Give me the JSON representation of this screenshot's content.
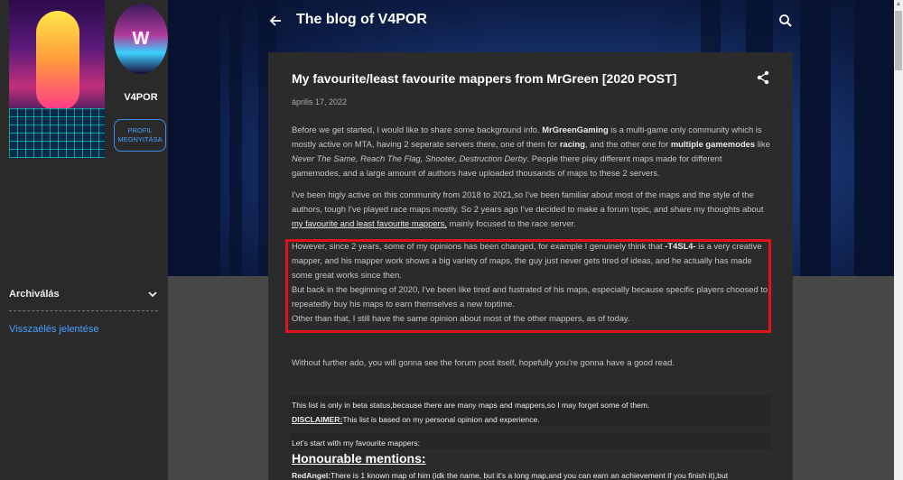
{
  "sidebar": {
    "profile_name": "V4POR",
    "profile_button_label": "PROFIL MEGNYITÁSA",
    "avatar_initial": "W",
    "archive_label": "Archiválás",
    "report_link": "Visszaélés jelentése",
    "icons": {
      "archive": "chevron-down-icon"
    }
  },
  "header": {
    "title": "The blog of V4POR",
    "icons": {
      "back": "arrow-left-icon",
      "search": "search-icon"
    }
  },
  "post": {
    "title": "My favourite/least favourite mappers from MrGreen [2020 POST]",
    "date": "április 17, 2022",
    "share_icon": "share-icon",
    "p1": {
      "t1": "Before we get started, I would like to share some background info. ",
      "b1": "MrGreenGaming",
      "t2": " is a multi-game only community which is mostly active on MTA, having 2 seperate servers there, one of them for ",
      "b2": "racing",
      "t3": ", and the other one for ",
      "b3": "multiple gamemodes",
      "t4": " like ",
      "i1": "Never The Same, Reach The Flag, Shooter, Destruction Derby",
      "t5": ". People there play different maps made for different gamemodes, and a large amount of authors have uploaded thousands of maps to these 2 servers."
    },
    "p2": {
      "t1": "I've been higly active on this community from 2018 to 2021,so I've been familiar about most of the maps and the style of the authors, tough I've played race maps mostly. So 2 years ago I've decided to make a forum topic, and share my thoughts about",
      "u1": " my favourite and least favourite mappers,",
      "t2": " mainly focused to the race server."
    },
    "p3": {
      "t1": "However, since 2 years, some of my opinions has been changed, for example I genuinely think that ",
      "b1": "-T4SL4-",
      "t2": " is a very creative mapper, and his mapper work shows a big variety of maps, the guy just never gets tired of ideas, and he actually has made some great works since then.",
      "line2": "But back in the beginning of 2020, I've been like tired and fustrated of his maps, especially because specific players choosed to repeatedly buy his maps to earn themselves a new toptime.",
      "line3": "Other than that, I still have the same opinion about most of the other mappers, as of today."
    },
    "p4": "Without further ado, you will gonna see the forum post itself, hopefully you're gonna have a good read.",
    "beta_note": "This list is only in beta status,because there are many maps and mappers,so I may forget some of them.",
    "disclaimer_label": "DISCLAIMER:",
    "disclaimer_text": "This list is based on my personal opinion and experience.",
    "start_text": "Let's start with my favourite mappers:",
    "honourable_heading": "Honourable mentions:",
    "redangel_label": "RedAngel:",
    "redangel_text": "There is 1 known map of him (idk the name, but it's a long map,and you can earn an achievement if you finish it),but"
  }
}
